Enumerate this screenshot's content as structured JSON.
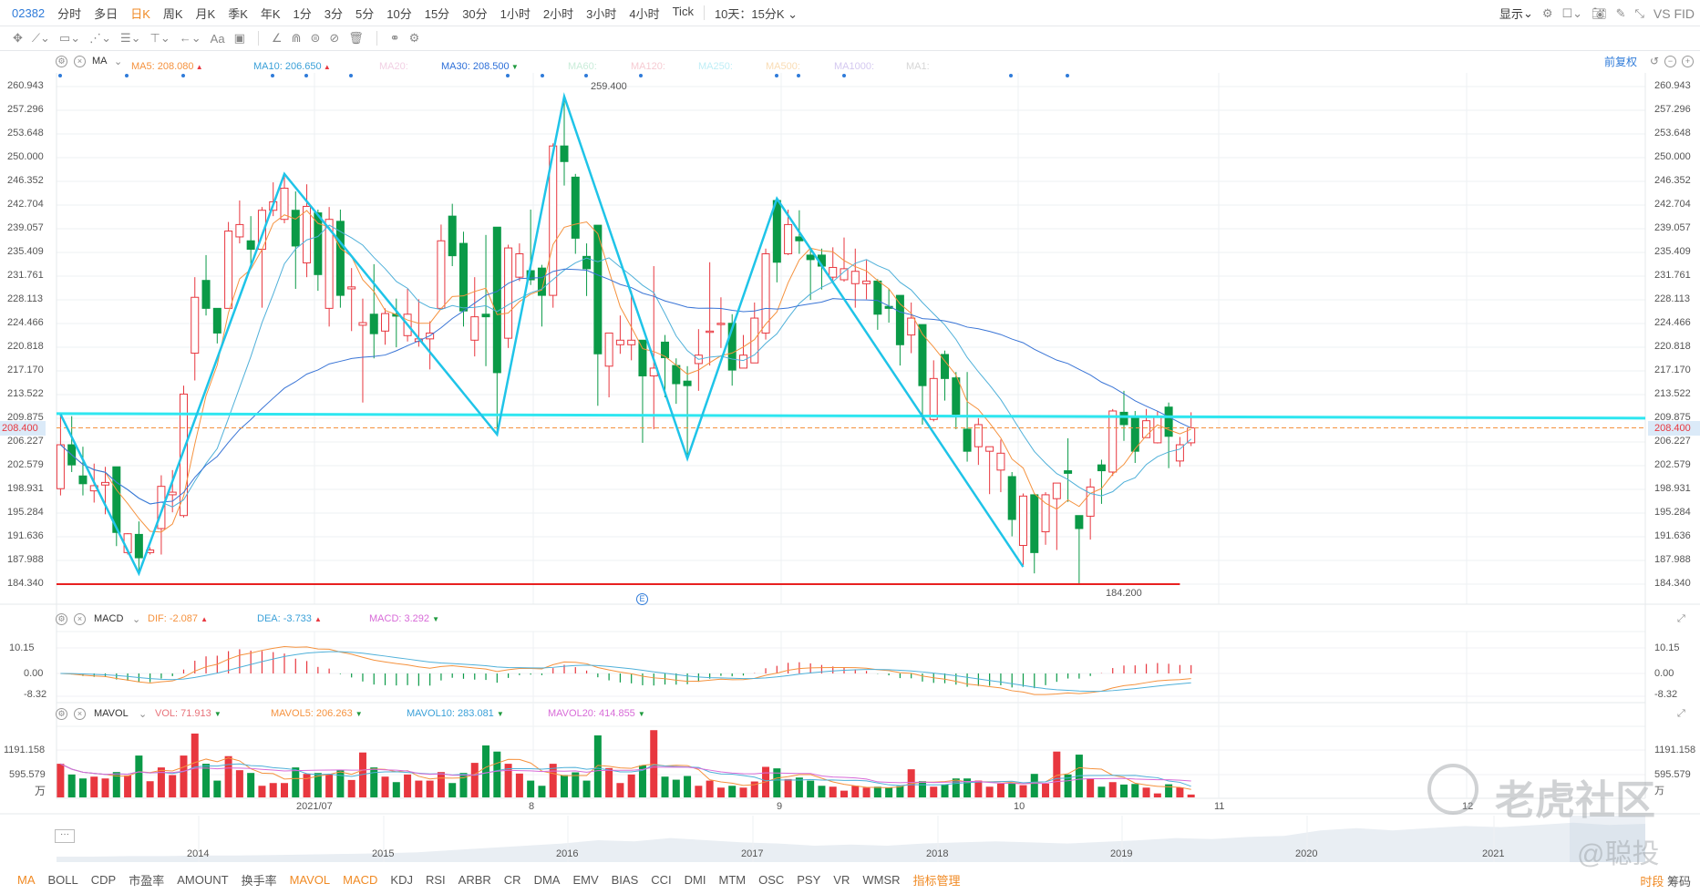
{
  "topbar": {
    "code": "02382",
    "tabs": [
      "分时",
      "多日",
      "日K",
      "周K",
      "月K",
      "季K",
      "年K",
      "1分",
      "3分",
      "5分",
      "10分",
      "15分",
      "30分",
      "1小时",
      "2小时",
      "3小时",
      "4小时",
      "Tick"
    ],
    "active_tab": "日K",
    "multi_day": "10天：15分K",
    "display_label": "显示",
    "vs_label": "VS FID"
  },
  "toolbar": {
    "text_tool": "Aa"
  },
  "main_legend": {
    "name": "MA",
    "items": [
      {
        "label": "MA5: 208.080",
        "color": "#f5923e",
        "trend": "up"
      },
      {
        "label": "MA10: 206.650",
        "color": "#3aa0d8",
        "trend": "up"
      },
      {
        "label": "MA20:",
        "color": "#f2d0e4"
      },
      {
        "label": "MA30: 208.500",
        "color": "#2d6fd8",
        "trend": "down"
      },
      {
        "label": "MA60:",
        "color": "#c9ecd9"
      },
      {
        "label": "MA120:",
        "color": "#f6cbd2"
      },
      {
        "label": "MA250:",
        "color": "#bfeef6"
      },
      {
        "label": "MA500:",
        "color": "#f9dcb4"
      },
      {
        "label": "MA1000:",
        "color": "#d4c8f0"
      },
      {
        "label": "MA1:",
        "color": "#d6d6d6"
      }
    ],
    "adjust": "前复权"
  },
  "price_axis": [
    "260.943",
    "257.296",
    "253.648",
    "250.000",
    "246.352",
    "242.704",
    "239.057",
    "235.409",
    "231.761",
    "228.113",
    "224.466",
    "220.818",
    "217.170",
    "213.522",
    "209.875",
    "206.227",
    "202.579",
    "198.931",
    "195.284",
    "191.636",
    "187.988",
    "184.340"
  ],
  "last_price": "208.400",
  "annotations": {
    "high": "259.400",
    "low": "184.200"
  },
  "macd_legend": {
    "name": "MACD",
    "dif": "DIF: -2.087",
    "dea": "DEA: -3.733",
    "macd": "MACD: 3.292",
    "axis": [
      "10.15",
      "0.00",
      "-8.32"
    ]
  },
  "vol_legend": {
    "name": "MAVOL",
    "vol": "VOL: 71.913",
    "mavol5": "MAVOL5: 206.263",
    "mavol10": "MAVOL10: 283.081",
    "mavol20": "MAVOL20: 414.855",
    "axis": [
      "1191.158",
      "595.579"
    ],
    "unit": "万"
  },
  "date_labels": [
    "2021/07",
    "8",
    "9",
    "10",
    "11",
    "12"
  ],
  "navigator": {
    "years": [
      "2014",
      "2015",
      "2016",
      "2017",
      "2018",
      "2019",
      "2020",
      "2021"
    ],
    "history": [
      10,
      10,
      11,
      11,
      12,
      12,
      13,
      14,
      15,
      16,
      18,
      22,
      26,
      30,
      34,
      40,
      38,
      44,
      40,
      36,
      34,
      30,
      32,
      30,
      34,
      36,
      38,
      36,
      34,
      37,
      40,
      44,
      42,
      46,
      48,
      58,
      62,
      58,
      62,
      66,
      64,
      68,
      72,
      68,
      70
    ]
  },
  "bottom_tabs": [
    {
      "label": "MA",
      "on": true
    },
    {
      "label": "BOLL"
    },
    {
      "label": "CDP"
    },
    {
      "label": "市盈率"
    },
    {
      "label": "AMOUNT"
    },
    {
      "label": "换手率"
    },
    {
      "label": "MAVOL",
      "on": true
    },
    {
      "label": "MACD",
      "on": true
    },
    {
      "label": "KDJ"
    },
    {
      "label": "RSI"
    },
    {
      "label": "ARBR"
    },
    {
      "label": "CR"
    },
    {
      "label": "DMA"
    },
    {
      "label": "EMV"
    },
    {
      "label": "BIAS"
    },
    {
      "label": "CCI"
    },
    {
      "label": "DMI"
    },
    {
      "label": "MTM"
    },
    {
      "label": "OSC"
    },
    {
      "label": "PSY"
    },
    {
      "label": "VR"
    },
    {
      "label": "WMSR"
    },
    {
      "label": "指标管理",
      "on": true
    }
  ],
  "bottom_right": {
    "period": "时段",
    "chips": "筹码"
  },
  "watermark": {
    "brand": "老虎社区",
    "author": "@聪投"
  },
  "colors": {
    "up": "#e8373f",
    "down": "#0a9a47",
    "ma5": "#f5923e",
    "ma10": "#4fb0d9",
    "ma30": "#3a75d6",
    "zigzag": "#1fc4e8",
    "support": "#e82020",
    "resistance": "#2ee6f0",
    "mavol20": "#d86bd8"
  },
  "chart_data": {
    "type": "candlestick",
    "ylim": [
      184.34,
      260.943
    ],
    "candles_ohlc": [
      [
        199.04,
        210.5,
        198.0,
        205.8
      ],
      [
        205.8,
        210.2,
        201.6,
        202.7
      ],
      [
        201.0,
        205.5,
        198.0,
        199.8
      ],
      [
        198.7,
        202.9,
        196.9,
        199.5
      ],
      [
        199.6,
        202.4,
        195.1,
        200.0
      ],
      [
        202.4,
        202.4,
        190.2,
        192.3
      ],
      [
        189.2,
        192.2,
        188.9,
        192.1
      ],
      [
        192.0,
        194.0,
        186.0,
        188.4
      ],
      [
        189.2,
        190.0,
        188.9,
        189.6
      ],
      [
        192.9,
        201.1,
        188.9,
        199.4
      ],
      [
        198.1,
        201.9,
        195.4,
        198.5
      ],
      [
        194.9,
        214.9,
        194.6,
        213.6
      ],
      [
        219.9,
        231.6,
        215.7,
        228.5
      ],
      [
        231.1,
        235.0,
        225.7,
        226.8
      ],
      [
        226.8,
        226.8,
        221.4,
        223.0
      ],
      [
        226.8,
        240.1,
        226.8,
        238.7
      ],
      [
        237.8,
        243.4,
        236.8,
        239.7
      ],
      [
        237.2,
        241.0,
        233.4,
        235.9
      ],
      [
        235.9,
        242.4,
        226.9,
        241.9
      ],
      [
        241.9,
        246.2,
        241.0,
        243.2
      ],
      [
        240.5,
        247.5,
        239.9,
        245.3
      ],
      [
        241.9,
        244.8,
        229.8,
        236.4
      ],
      [
        233.8,
        245.9,
        231.6,
        242.5
      ],
      [
        241.5,
        242.0,
        229.5,
        232.0
      ],
      [
        226.8,
        242.4,
        224.0,
        240.5
      ],
      [
        240.2,
        242.0,
        226.9,
        228.8
      ],
      [
        229.8,
        233.0,
        223.3,
        230.1
      ],
      [
        224.2,
        228.3,
        212.3,
        224.6
      ],
      [
        225.9,
        233.6,
        219.1,
        222.9
      ],
      [
        223.3,
        226.8,
        221.2,
        226.0
      ],
      [
        225.9,
        228.3,
        220.8,
        225.6
      ],
      [
        222.6,
        229.8,
        221.7,
        225.9
      ],
      [
        221.7,
        228.2,
        220.9,
        222.1
      ],
      [
        222.1,
        224.8,
        217.4,
        223.0
      ],
      [
        226.8,
        239.7,
        226.8,
        237.2
      ],
      [
        241.0,
        242.9,
        233.3,
        234.9
      ],
      [
        236.8,
        238.6,
        224.0,
        226.4
      ],
      [
        221.9,
        231.6,
        219.4,
        225.5
      ],
      [
        225.9,
        238.1,
        217.9,
        225.5
      ],
      [
        239.3,
        239.3,
        207.4,
        216.9
      ],
      [
        222.2,
        236.6,
        220.7,
        236.1
      ],
      [
        231.6,
        236.8,
        231.0,
        235.2
      ],
      [
        232.6,
        242.0,
        230.4,
        231.2
      ],
      [
        233.0,
        233.5,
        224.0,
        228.8
      ],
      [
        228.8,
        252.2,
        226.9,
        251.8
      ],
      [
        251.8,
        259.4,
        245.7,
        249.4
      ],
      [
        247.0,
        247.5,
        235.2,
        237.6
      ],
      [
        234.8,
        236.8,
        228.7,
        232.9
      ],
      [
        239.6,
        239.6,
        211.8,
        219.8
      ],
      [
        217.9,
        223.0,
        213.1,
        223.0
      ],
      [
        221.2,
        225.7,
        219.8,
        221.9
      ],
      [
        221.2,
        229.5,
        218.8,
        221.9
      ],
      [
        221.9,
        221.9,
        206.1,
        216.4
      ],
      [
        216.4,
        233.3,
        208.2,
        217.6
      ],
      [
        221.6,
        222.7,
        213.1,
        219.2
      ],
      [
        218.0,
        219.1,
        212.1,
        215.2
      ],
      [
        215.6,
        217.9,
        203.7,
        214.9
      ],
      [
        218.3,
        223.6,
        214.1,
        219.6
      ],
      [
        223.1,
        233.9,
        218.0,
        223.3
      ],
      [
        224.3,
        228.5,
        220.7,
        224.5
      ],
      [
        224.5,
        225.9,
        214.9,
        217.3
      ],
      [
        217.6,
        222.7,
        217.6,
        219.6
      ],
      [
        218.4,
        227.7,
        218.4,
        225.3
      ],
      [
        223.0,
        236.0,
        222.0,
        235.2
      ],
      [
        243.4,
        243.7,
        230.8,
        233.9
      ],
      [
        235.2,
        242.0,
        235.0,
        239.7
      ],
      [
        237.8,
        241.9,
        235.2,
        237.2
      ],
      [
        235.0,
        236.1,
        228.1,
        234.3
      ],
      [
        235.0,
        236.0,
        229.7,
        233.3
      ],
      [
        231.6,
        236.2,
        231.1,
        233.1
      ],
      [
        231.2,
        237.7,
        230.9,
        232.9
      ],
      [
        230.6,
        236.0,
        226.9,
        232.5
      ],
      [
        230.6,
        234.2,
        228.2,
        231.0
      ],
      [
        231.0,
        231.3,
        223.5,
        225.9
      ],
      [
        227.1,
        229.8,
        224.6,
        226.8
      ],
      [
        228.8,
        228.8,
        218.0,
        221.2
      ],
      [
        222.7,
        227.7,
        219.9,
        225.3
      ],
      [
        224.3,
        224.3,
        208.9,
        214.9
      ],
      [
        209.7,
        218.8,
        209.4,
        216.0
      ],
      [
        219.7,
        220.3,
        212.6,
        216.0
      ],
      [
        216.1,
        217.0,
        208.2,
        210.5
      ],
      [
        208.2,
        217.0,
        203.2,
        204.8
      ],
      [
        205.5,
        209.9,
        202.7,
        208.9
      ],
      [
        204.8,
        205.5,
        198.2,
        205.5
      ],
      [
        201.9,
        206.6,
        198.5,
        204.5
      ],
      [
        200.9,
        201.6,
        191.7,
        194.3
      ],
      [
        190.3,
        198.3,
        187.3,
        197.9
      ],
      [
        198.1,
        198.1,
        186.0,
        189.2
      ],
      [
        192.4,
        198.5,
        190.4,
        198.1
      ],
      [
        197.5,
        199.9,
        189.6,
        199.9
      ],
      [
        201.8,
        206.8,
        197.0,
        201.4
      ],
      [
        194.9,
        194.9,
        184.2,
        192.9
      ],
      [
        194.8,
        200.6,
        191.2,
        199.3
      ],
      [
        202.7,
        203.5,
        196.7,
        201.8
      ],
      [
        201.6,
        211.3,
        201.0,
        211.0
      ],
      [
        210.8,
        214.1,
        206.4,
        208.9
      ],
      [
        210.1,
        211.0,
        203.0,
        204.8
      ],
      [
        206.9,
        211.3,
        206.9,
        209.5
      ],
      [
        206.1,
        211.0,
        206.0,
        210.2
      ],
      [
        211.6,
        212.3,
        202.2,
        207.1
      ],
      [
        203.3,
        207.0,
        202.4,
        205.8
      ],
      [
        206.1,
        210.8,
        205.6,
        208.4
      ]
    ],
    "volume": [
      845,
      576,
      476,
      522,
      476,
      637,
      553,
      1052,
      407,
      753,
      561,
      1052,
      1605,
      845,
      422,
      1037,
      684,
      614,
      292,
      361,
      361,
      753,
      591,
      614,
      576,
      676,
      438,
      1129,
      753,
      522,
      384,
      576,
      422,
      422,
      637,
      361,
      614,
      868,
      1306,
      1152,
      845,
      599,
      422,
      292,
      845,
      561,
      630,
      422,
      1559,
      737,
      361,
      576,
      806,
      1690,
      522,
      445,
      538,
      292,
      422,
      246,
      292,
      246,
      400,
      768,
      730,
      461,
      499,
      422,
      292,
      269,
      169,
      292,
      246,
      269,
      246,
      284,
      707,
      407,
      269,
      323,
      476,
      476,
      422,
      269,
      346,
      369,
      307,
      591,
      346,
      1152,
      576,
      1075,
      476,
      269,
      384,
      323,
      338,
      246,
      100,
      330,
      253,
      72
    ],
    "zigzag": [
      [
        0,
        210.5
      ],
      [
        7,
        186.0
      ],
      [
        20,
        247.5
      ],
      [
        39,
        207.4
      ],
      [
        45,
        259.4
      ],
      [
        56,
        203.7
      ],
      [
        64,
        243.7
      ],
      [
        86,
        187.0
      ]
    ],
    "resistance_line": [
      210.6,
      209.9
    ],
    "support_line": 184.34,
    "macd_ylim": [
      -8.32,
      10.15
    ],
    "vol_ylim": [
      0,
      1191.158
    ]
  }
}
